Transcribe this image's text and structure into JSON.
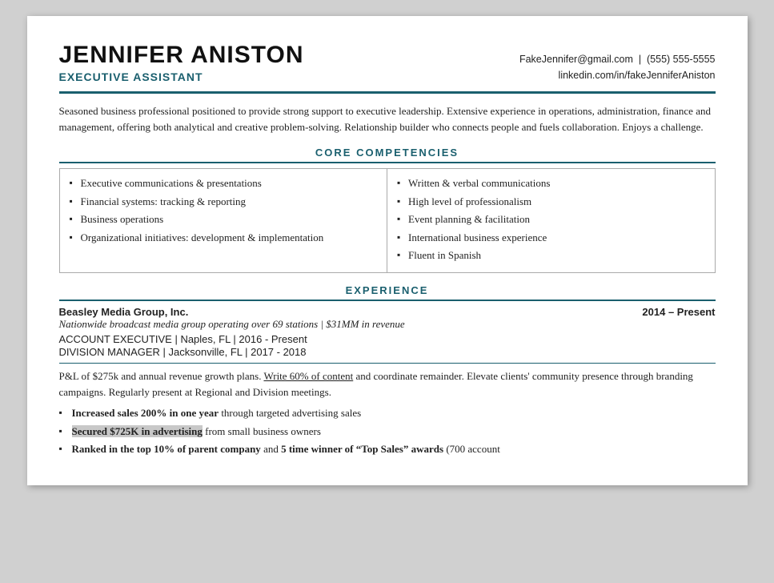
{
  "header": {
    "name": "JENNIFER ANISTON",
    "title": "EXECUTIVE ASSISTANT",
    "email": "FakeJennifer@gmail.com",
    "phone": "(555) 555-5555",
    "linkedin": "linkedin.com/in/fakeJenniferAniston"
  },
  "summary": {
    "text": "Seasoned business professional positioned to provide strong support to executive leadership. Extensive experience in operations, administration, finance and management, offering both analytical and creative problem-solving. Relationship builder who connects people and fuels collaboration. Enjoys a challenge."
  },
  "core_competencies": {
    "title": "CORE COMPETENCIES",
    "left_column": [
      "Executive communications & presentations",
      "Financial systems: tracking & reporting",
      "Business operations",
      "Organizational initiatives: development & implementation"
    ],
    "right_column": [
      "Written & verbal communications",
      "High level of professionalism",
      "Event planning & facilitation",
      "International business experience",
      "Fluent in Spanish"
    ]
  },
  "experience": {
    "title": "EXPERIENCE",
    "jobs": [
      {
        "company": "Beasley Media Group, Inc.",
        "dates": "2014 – Present",
        "description": "Nationwide broadcast media group operating over 69 stations | $31MM in revenue",
        "roles": [
          "ACCOUNT EXECUTIVE | Naples, FL | 2016 - Present",
          "DIVISION MANAGER | Jacksonville, FL | 2017 - 2018"
        ],
        "body": "P&L of $275k and annual revenue growth plans. Write 60% of content and coordinate remainder. Elevate clients' community presence through branding campaigns. Regularly present at Regional and Division meetings.",
        "bullets": [
          {
            "text_bold": "Increased sales 200% in one year",
            "text_normal": " through targeted advertising sales",
            "highlighted": false
          },
          {
            "text_bold": "Secured $725K in advertising",
            "text_normal": " from small business owners",
            "highlighted": true
          },
          {
            "text_bold": "Ranked in the top 10% of parent company",
            "text_normal": " and ",
            "text_bold2": "5 time winner of “Top Sales” awards",
            "text_normal2": " (700 account",
            "highlighted": false
          }
        ]
      }
    ]
  }
}
